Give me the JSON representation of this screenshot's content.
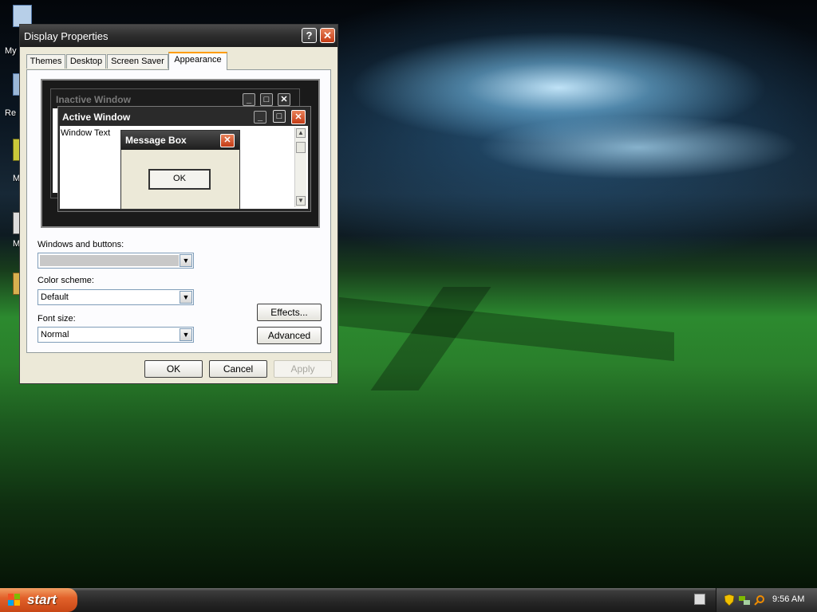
{
  "desktop": {
    "icons": [
      {
        "label": "My"
      },
      {
        "label": "Re"
      },
      {
        "label": "M"
      },
      {
        "label": "M"
      },
      {
        "label": ""
      }
    ]
  },
  "dialog": {
    "title": "Display Properties",
    "help_glyph": "?",
    "close_glyph": "✕",
    "tabs": [
      "Themes",
      "Desktop",
      "Screen Saver",
      "Appearance"
    ],
    "active_tab": "Appearance",
    "preview": {
      "inactive_title": "Inactive Window",
      "active_title": "Active Window",
      "window_text": "Window Text",
      "message_box_title": "Message Box",
      "message_box_ok": "OK"
    },
    "windows_buttons_label": "Windows and buttons:",
    "windows_buttons_value": "",
    "color_scheme_label": "Color scheme:",
    "color_scheme_value": "Default",
    "font_size_label": "Font size:",
    "font_size_value": "Normal",
    "effects_label": "Effects...",
    "advanced_label": "Advanced",
    "ok_label": "OK",
    "cancel_label": "Cancel",
    "apply_label": "Apply"
  },
  "taskbar": {
    "start_label": "start",
    "clock": "9:56 AM"
  },
  "colors": {
    "start_orange": "#e2622b",
    "close_red": "#c43b15",
    "tab_highlight": "#ff9c00",
    "dialog_face": "#ece9d8"
  }
}
